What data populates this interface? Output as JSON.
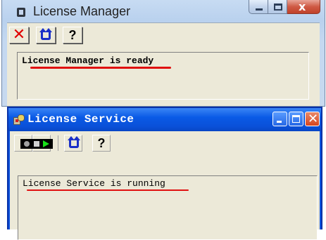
{
  "license_manager": {
    "title": "License Manager",
    "window_controls": {
      "minimize": "–",
      "maximize": "□",
      "close": "x"
    },
    "toolbar": {
      "stop_icon": "red-x-icon",
      "refresh_icon": "blue-refresh-icon",
      "help_label": "?"
    },
    "status_message": "License Manager is ready"
  },
  "license_service": {
    "title": "License Service",
    "window_controls": {
      "minimize": "_",
      "maximize": "□",
      "close": "×"
    },
    "toolbar": {
      "stop_icon": "stop-icon",
      "start_icon": "play-icon",
      "refresh_icon": "blue-refresh-icon",
      "help_label": "?"
    },
    "led_state": "running",
    "status_message": "License Service is running"
  },
  "colors": {
    "annotation_underline": "#e01010",
    "xp_titlebar": "#0a5ae6",
    "led_running": "#18e018"
  }
}
